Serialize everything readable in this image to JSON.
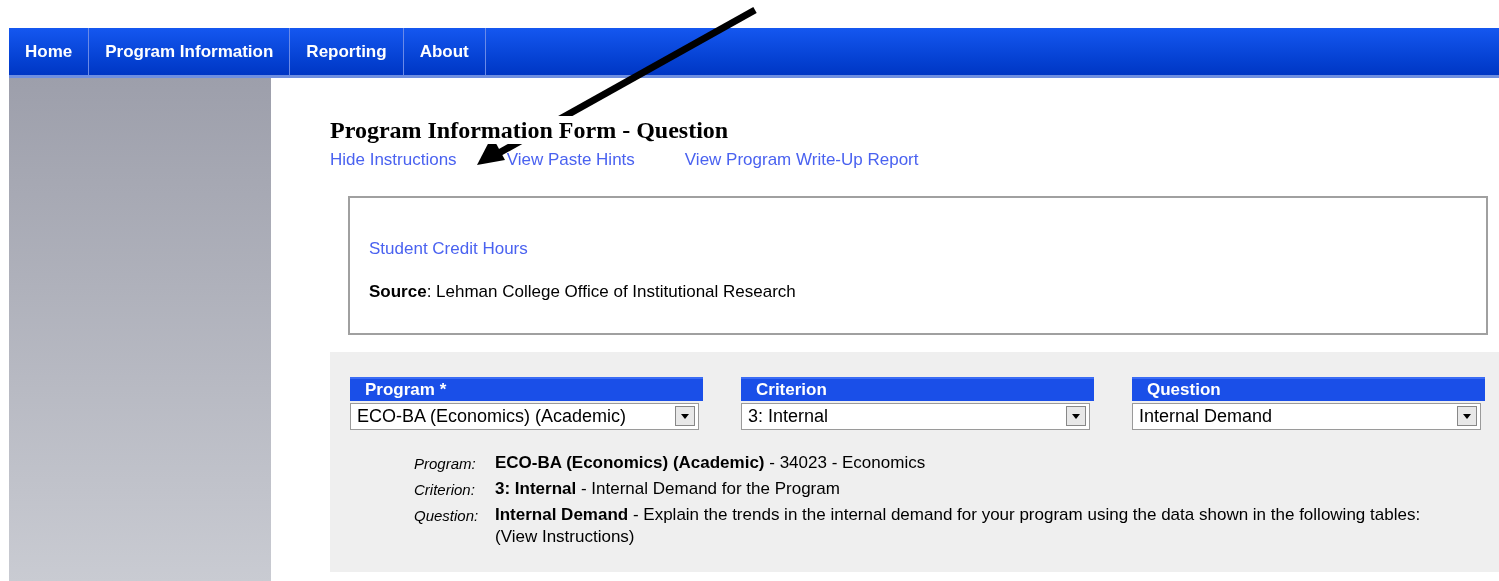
{
  "nav": [
    {
      "label": "Home"
    },
    {
      "label": "Program Information"
    },
    {
      "label": "Reporting"
    },
    {
      "label": "About"
    }
  ],
  "title": "Program Information Form - Question",
  "links": [
    "Hide Instructions",
    "View Paste Hints",
    "View Program Write-Up Report"
  ],
  "info_box": {
    "link": "Student Credit Hours",
    "source": "**Source**: Lehman College Office of Institutional Research"
  },
  "selectors": [
    {
      "label": "Program *",
      "value": "ECO-BA (Economics) (Academic)"
    },
    {
      "label": "Criterion",
      "value": "3: Internal"
    },
    {
      "label": "Question",
      "value": "Internal Demand"
    }
  ],
  "details": [
    {
      "label": "Program:",
      "text": "**ECO-BA (Economics) (Academic)** - 34023 - Economics"
    },
    {
      "label": "Criterion:",
      "text": "**3: Internal** - Internal Demand for the Program"
    },
    {
      "label": "Question:",
      "text": "**Internal Demand** - Explain the trends in the internal demand for your program using the data shown in the following tables: (View Instructions)"
    }
  ]
}
